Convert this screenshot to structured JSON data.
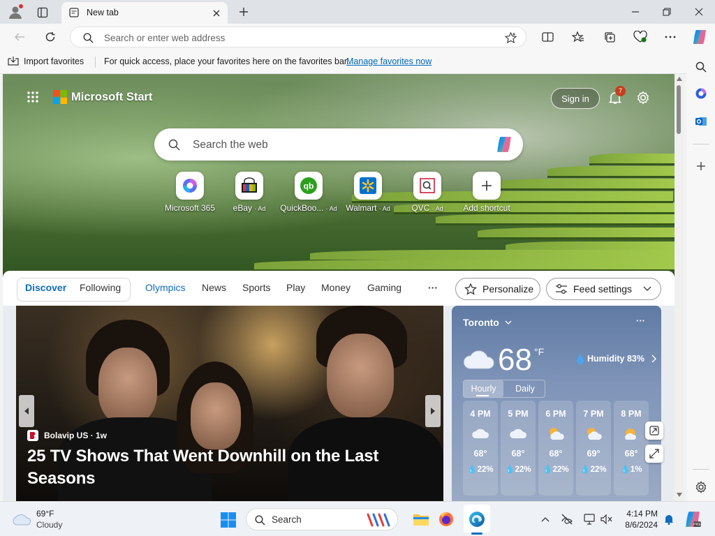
{
  "browser": {
    "tab_title": "New tab",
    "address_placeholder": "Search or enter web address"
  },
  "favorites_bar": {
    "import_label": "Import favorites",
    "message": "For quick access, place your favorites here on the favorites bar.",
    "manage_link": "Manage favorites now"
  },
  "start": {
    "brand": "Microsoft Start",
    "sign_in": "Sign in",
    "notification_count": "7",
    "search_placeholder": "Search the web",
    "shortcuts": [
      {
        "label": "Microsoft 365",
        "ad": ""
      },
      {
        "label": "eBay",
        "ad": "· Ad"
      },
      {
        "label": "QuickBoo...",
        "ad": "· Ad"
      },
      {
        "label": "Walmart",
        "ad": "· Ad"
      },
      {
        "label": "QVC",
        "ad": "· Ad"
      },
      {
        "label": "Add shortcut",
        "ad": ""
      }
    ]
  },
  "nav": {
    "tabs": [
      "Discover",
      "Following",
      "Olympics",
      "News",
      "Sports",
      "Play",
      "Money",
      "Gaming"
    ],
    "more": "···",
    "personalize": "Personalize",
    "feed_settings": "Feed settings"
  },
  "news": {
    "source": "Bolavip US · 1w",
    "headline": "25 TV Shows That Went Downhill on the Last Seasons"
  },
  "weather": {
    "city": "Toronto",
    "temp": "68",
    "unit": "°F",
    "humidity": "Humidity 83%",
    "modes": [
      "Hourly",
      "Daily"
    ],
    "hourly": [
      {
        "time": "4 PM",
        "temp": "68°",
        "precip": "22%"
      },
      {
        "time": "5 PM",
        "temp": "68°",
        "precip": "22%"
      },
      {
        "time": "6 PM",
        "temp": "68°",
        "precip": "22%"
      },
      {
        "time": "7 PM",
        "temp": "69°",
        "precip": "22%"
      },
      {
        "time": "8 PM",
        "temp": "68°",
        "precip": "1%"
      }
    ]
  },
  "taskbar": {
    "weather_temp": "69°F",
    "weather_desc": "Cloudy",
    "search_label": "Search",
    "time": "4:14 PM",
    "date": "8/6/2024"
  },
  "colors": {
    "accent": "#0f6cbd",
    "link": "#0067b8",
    "badge": "#c43e1c"
  }
}
